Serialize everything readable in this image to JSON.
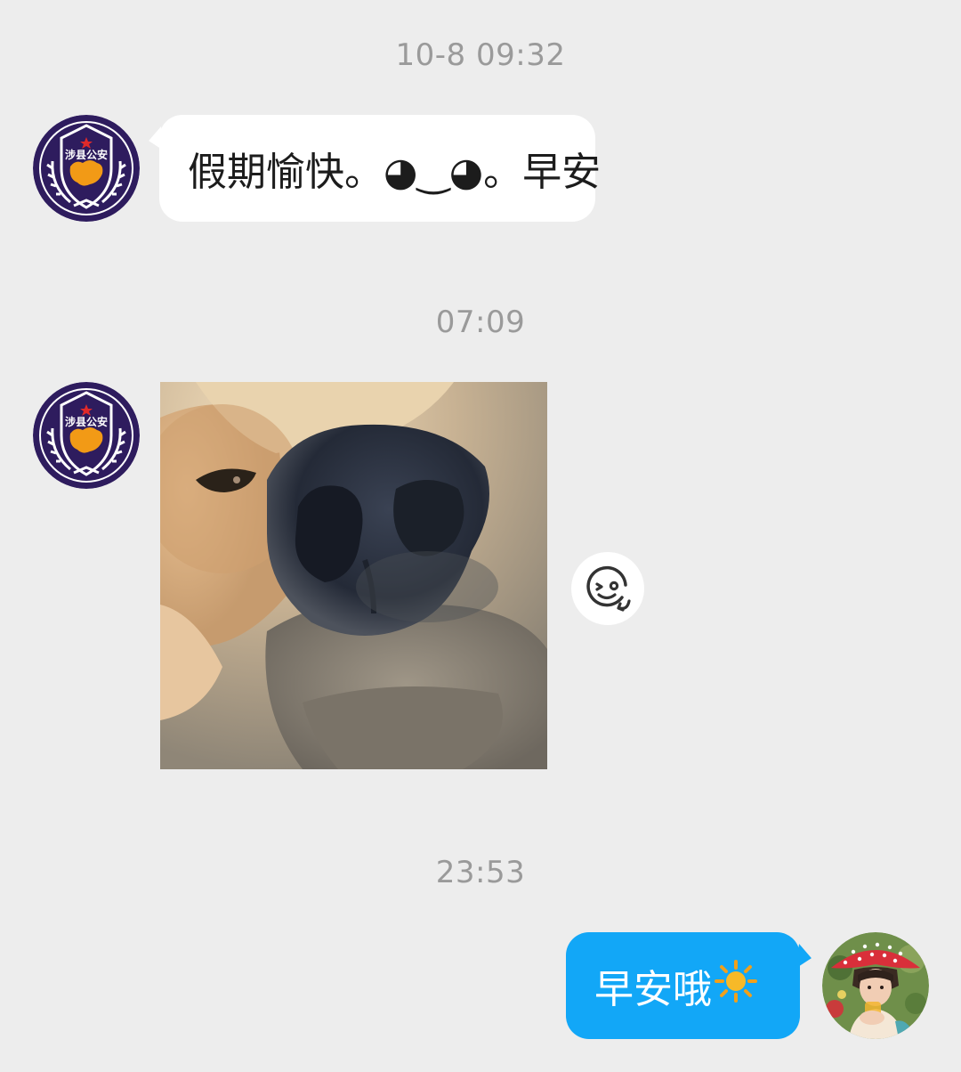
{
  "colors": {
    "background": "#ededed",
    "timestamp_text": "#9a9a9a",
    "incoming_bubble": "#ffffff",
    "outgoing_bubble": "#12a7f7",
    "badge_purple": "#2e1c5e",
    "badge_orange": "#f29a16"
  },
  "messages": [
    {
      "timestamp": "10-8 09:32",
      "direction": "incoming",
      "type": "text",
      "sender_avatar": "police-badge-avatar",
      "avatar_text": "涉县公安",
      "text": "假期愉快。◕‿◕。早安"
    },
    {
      "timestamp": "07:09",
      "direction": "incoming",
      "type": "sticker",
      "sender_avatar": "police-badge-avatar",
      "avatar_text": "涉县公安",
      "sticker_subject": "dog-nose-closeup",
      "action_icon": "sticker-reaction-icon"
    },
    {
      "timestamp": "23:53",
      "direction": "outgoing",
      "type": "text",
      "sender_avatar": "user-photo-avatar",
      "text": "早安哦",
      "emoji": "sun-emoji"
    }
  ]
}
